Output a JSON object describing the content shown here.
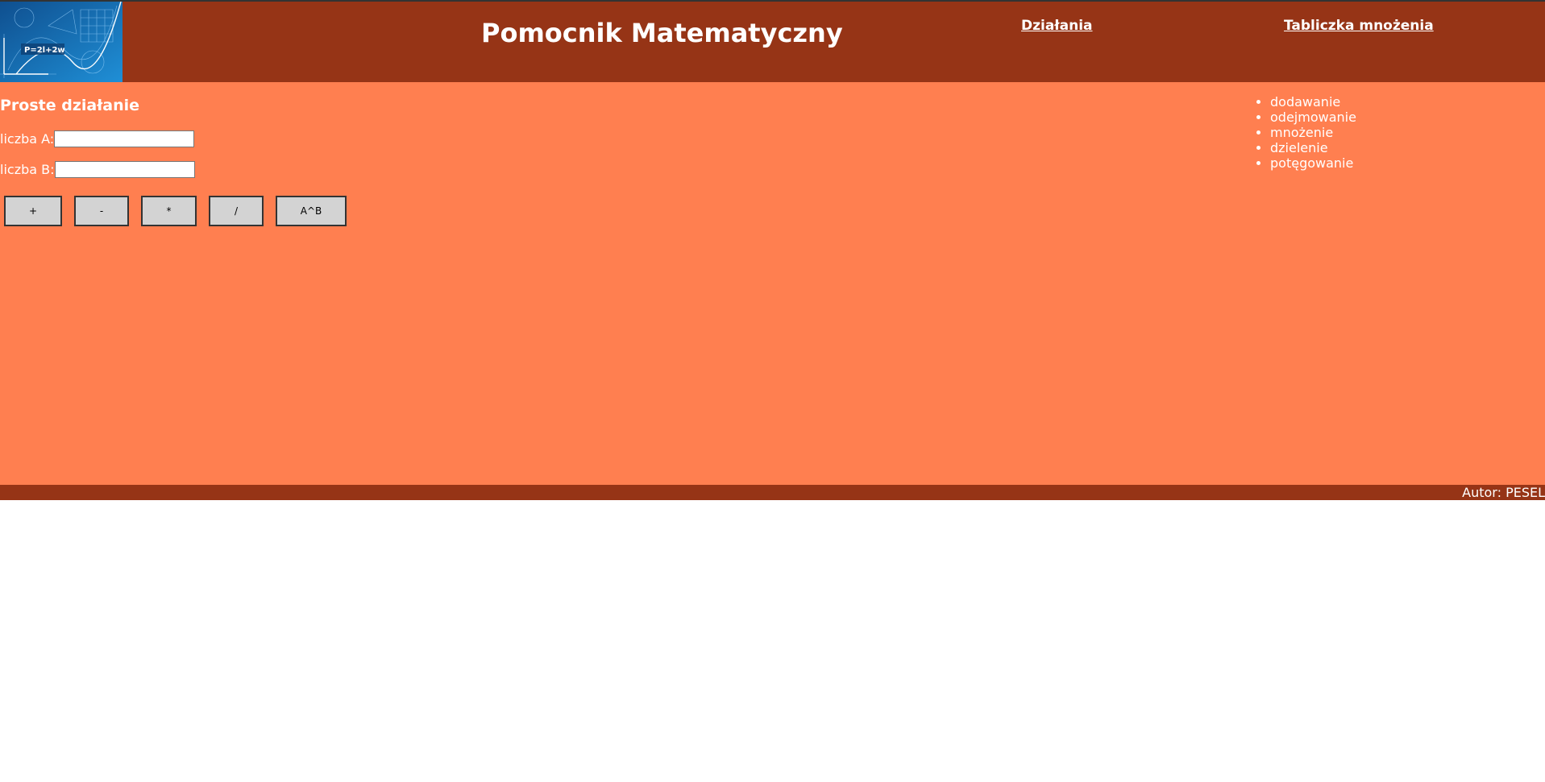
{
  "header": {
    "title": "Pomocnik Matematyczny",
    "logo_text": "P=2l+2w",
    "nav": [
      {
        "label": "Działania"
      },
      {
        "label": "Tabliczka mnożenia"
      }
    ]
  },
  "main": {
    "heading": "Proste działanie",
    "fields": [
      {
        "label": "liczba A:",
        "value": "",
        "placeholder": ""
      },
      {
        "label": "liczba B:",
        "value": "",
        "placeholder": ""
      }
    ],
    "buttons": [
      {
        "label": "+"
      },
      {
        "label": "-"
      },
      {
        "label": "*"
      },
      {
        "label": "/"
      },
      {
        "label": "A^B"
      }
    ],
    "operations": [
      "dodawanie",
      "odejmowanie",
      "mnożenie",
      "dzielenie",
      "potęgowanie"
    ]
  },
  "footer": {
    "author": "Autor: PESEL"
  },
  "colors": {
    "header_bg": "#963416",
    "content_bg": "#ff7f50",
    "button_bg": "#d3d3d3",
    "text": "#ffffff"
  }
}
